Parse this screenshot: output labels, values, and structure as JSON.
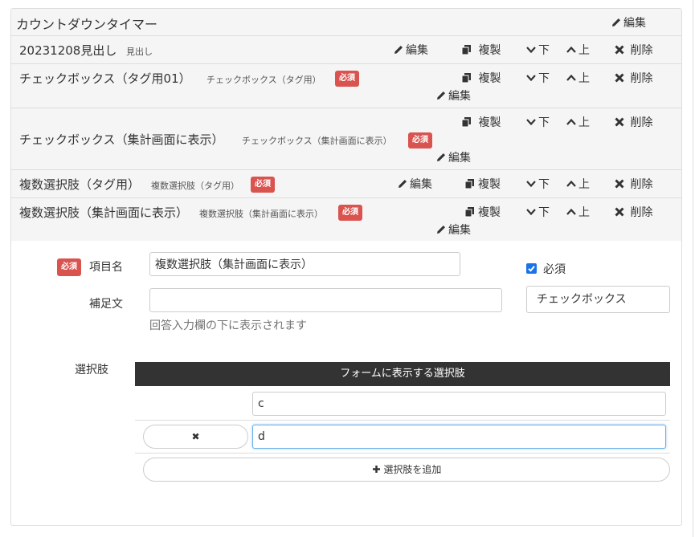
{
  "form_title": "カウントダウンタイマー",
  "form_edit_label": "編集",
  "fields": [
    {
      "title": "20231208見出し",
      "subtitle": "見出し",
      "required": "",
      "edit": "編集",
      "copy": "複製",
      "down": "下",
      "up": "上",
      "delete": "削除"
    },
    {
      "title": "チェックボックス（タグ用01）",
      "subtitle": "チェックボックス（タグ用）",
      "required": "必須",
      "edit": "編集",
      "copy": "複製",
      "down": "下",
      "up": "上",
      "delete": "削除"
    },
    {
      "title": "チェックボックス（集計画面に表示）",
      "subtitle": "チェックボックス（集計画面に表示）",
      "required": "必須",
      "edit": "編集",
      "copy": "複製",
      "down": "下",
      "up": "上",
      "delete": "削除"
    },
    {
      "title": "複数選択肢（タグ用）",
      "subtitle": "複数選択肢（タグ用）",
      "required": "必須",
      "edit": "編集",
      "copy": "複製",
      "down": "下",
      "up": "上",
      "delete": "削除"
    },
    {
      "title": "複数選択肢（集計画面に表示）",
      "subtitle": "複数選択肢（集計画面に表示）",
      "required": "必須",
      "edit": "編集",
      "copy": "複製",
      "down": "下",
      "up": "上",
      "delete": "削除"
    }
  ],
  "editor": {
    "required_badge": "必須",
    "item_name_label": "項目名",
    "item_name_value": "複数選択肢（集計画面に表示）",
    "required_checkbox_label": "必須",
    "required_checked": true,
    "supplement_label": "補足文",
    "supplement_value": "",
    "type_value": "チェックボックス",
    "supplement_help": "回答入力欄の下に表示されます",
    "choices_label": "選択肢",
    "choices_header": "フォームに表示する選択肢",
    "choices": [
      "c",
      "d"
    ],
    "remove_choice_symbol": "✖",
    "add_choice_label": "選択肢を追加"
  },
  "colors": {
    "badge": "#d9534f",
    "header_bg": "#f5f5f5",
    "table_head": "#333333",
    "focus": "#66afe9",
    "checkbox": "#1a73e8"
  }
}
